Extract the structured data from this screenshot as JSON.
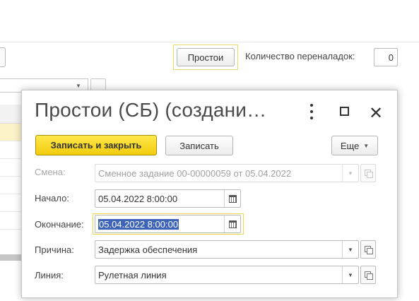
{
  "background": {
    "downtime_button": "Простои",
    "changeover_label": "Количество переналадок:",
    "changeover_value": "0"
  },
  "dialog": {
    "title": "Простои (СБ) (создани…",
    "buttons": {
      "save_close": "Записать и закрыть",
      "save": "Записать",
      "more": "Еще"
    },
    "fields": {
      "shift": {
        "label": "Смена:",
        "value": "Сменное задание 00-00000059 от 05.04.2022"
      },
      "start": {
        "label": "Начало:",
        "value": "05.04.2022  8:00:00"
      },
      "end": {
        "label": "Окончание:",
        "value": "05.04.2022  8:00:00"
      },
      "reason": {
        "label": "Причина:",
        "value": "Задержка обеспечения"
      },
      "line": {
        "label": "Линия:",
        "value": "Рулетная линия"
      }
    }
  },
  "colors": {
    "primary_button": "#f2cc0c",
    "focus_frame": "#f0d84a",
    "selection": "#3d64b8"
  },
  "icons": [
    "more-vert-icon",
    "maximize-icon",
    "close-icon",
    "calendar-icon",
    "dropdown-arrow-icon",
    "open-copy-icon"
  ]
}
